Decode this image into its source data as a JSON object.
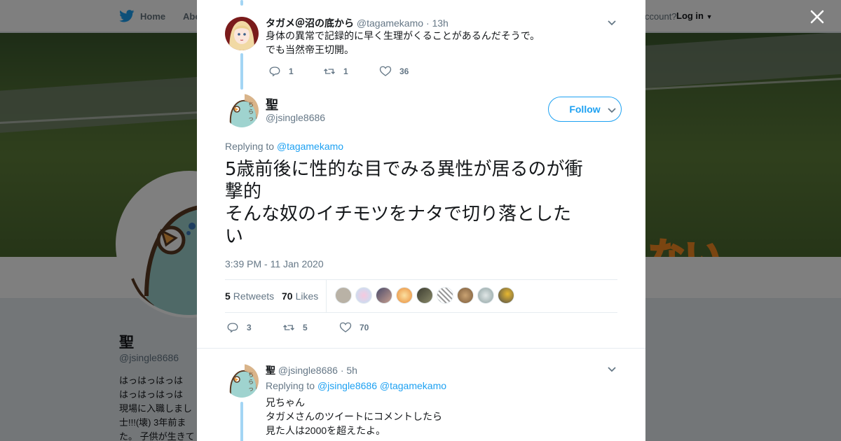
{
  "nav": {
    "home_label": "Home",
    "about_label": "Abo",
    "account_prompt": "ccount?",
    "login_label": "Log in"
  },
  "banner": {
    "overlay_text": "ない"
  },
  "profile": {
    "name": "聖",
    "handle": "@jsingle8686",
    "bio_lines": [
      "はっはっはっは",
      "はっはっはっは",
      "現場に入職しまし",
      "士!!!(壊) 3年前ま",
      "た。 子供が生きて"
    ]
  },
  "ancestor_tweet": {
    "name": "タガメ＠沼の底から",
    "handle": "@tagamekamo",
    "time": "· 13h",
    "text_lines": [
      "身体の異常で記録的に早く生理がくることがあるんだそうで。",
      "でも当然帝王切開。"
    ],
    "replies": "1",
    "retweets": "1",
    "likes": "36"
  },
  "main_tweet": {
    "name": "聖",
    "handle": "@jsingle8686",
    "follow_label": "Follow",
    "replying_prefix": "Replying to",
    "replying_to": "@tagamekamo",
    "text_lines": [
      "5歳前後に性的な目でみる異性が居るのが衝",
      "撃的",
      "そんな奴のイチモツをナタで切り落とした",
      "い"
    ],
    "timestamp": "3:39 PM - 11 Jan 2020",
    "retweets_count": "5",
    "retweets_label": "Retweets",
    "likes_count": "70",
    "likes_label": "Likes",
    "replies": "3",
    "retweets": "5",
    "likes": "70"
  },
  "reply_tweet": {
    "name": "聖",
    "handle": "@jsingle8686",
    "time": "· 5h",
    "replying_prefix": "Replying to",
    "replying_to_1": "@jsingle8686",
    "replying_to_2": "@tagamekamo",
    "text_lines": [
      "兄ちゃん",
      "タガメさんのツイートにコメントしたら",
      "見た人は2000を超えたよ。"
    ]
  },
  "colors": {
    "accent": "#1da1f2",
    "thread": "#a3d5f4",
    "like": "#e0245e",
    "muted": "#657786"
  }
}
